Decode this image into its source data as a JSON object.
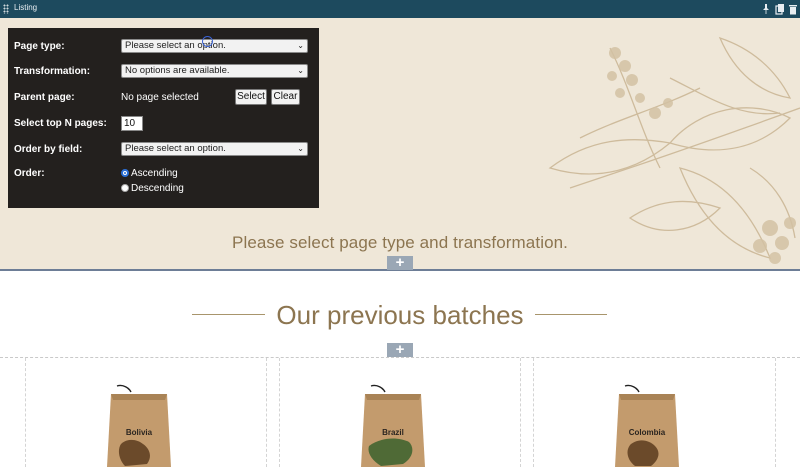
{
  "widget_bar": {
    "title": "Listing",
    "icons": [
      "drag-handle-icon",
      "pin-icon",
      "copy-icon",
      "delete-icon"
    ]
  },
  "config": {
    "page_type": {
      "label": "Page type:",
      "value": "Please select an option."
    },
    "transformation": {
      "label": "Transformation:",
      "value": "No options are available."
    },
    "parent_page": {
      "label": "Parent page:",
      "value": "No page selected",
      "select_label": "Select",
      "clear_label": "Clear"
    },
    "top_n": {
      "label": "Select top N pages:",
      "value": "10"
    },
    "order_by": {
      "label": "Order by field:",
      "value": "Please select an option."
    },
    "order": {
      "label": "Order:",
      "options": [
        "Ascending",
        "Descending"
      ],
      "selected": "Ascending"
    }
  },
  "hero": {
    "message": "Please select page type and transformation."
  },
  "section": {
    "title": "Our previous batches"
  },
  "products": [
    {
      "name": "Bolivia",
      "map_color": "#6b4a2a"
    },
    {
      "name": "Brazil",
      "map_color": "#4f6a36"
    },
    {
      "name": "Colombia",
      "map_color": "#6b4a2a"
    }
  ],
  "colors": {
    "widget_bar": "#1d4a5e",
    "hero_bg": "#efe7d8",
    "accent_text": "#8c7550",
    "panel_bg": "#23201e"
  }
}
